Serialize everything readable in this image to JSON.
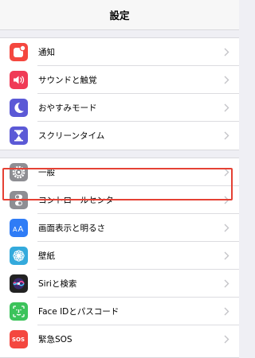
{
  "nav": {
    "title": "設定"
  },
  "group1": [
    {
      "label": "通知",
      "icon": "notifications-icon",
      "color": "#f4473f"
    },
    {
      "label": "サウンドと触覚",
      "icon": "speaker-icon",
      "color": "#f03a56"
    },
    {
      "label": "おやすみモード",
      "icon": "moon-icon",
      "color": "#5b59d6"
    },
    {
      "label": "スクリーンタイム",
      "icon": "hourglass-icon",
      "color": "#5b59d6"
    }
  ],
  "group2": [
    {
      "label": "一般",
      "icon": "gear-icon",
      "color": "#8e8e93"
    },
    {
      "label": "コントロールセンター",
      "icon": "toggles-icon",
      "color": "#8e8e93"
    },
    {
      "label": "画面表示と明るさ",
      "icon": "text-size-icon",
      "color": "#2f7cf6"
    },
    {
      "label": "壁紙",
      "icon": "flower-icon",
      "color": "#34aadc"
    },
    {
      "label": "Siriと検索",
      "icon": "siri-icon",
      "color": "#222"
    },
    {
      "label": "Face IDとパスコード",
      "icon": "face-id-icon",
      "color": "#3cc35b"
    },
    {
      "label": "緊急SOS",
      "icon": "sos-icon",
      "color": "#f4473f"
    }
  ],
  "highlight_color": "#e54134"
}
